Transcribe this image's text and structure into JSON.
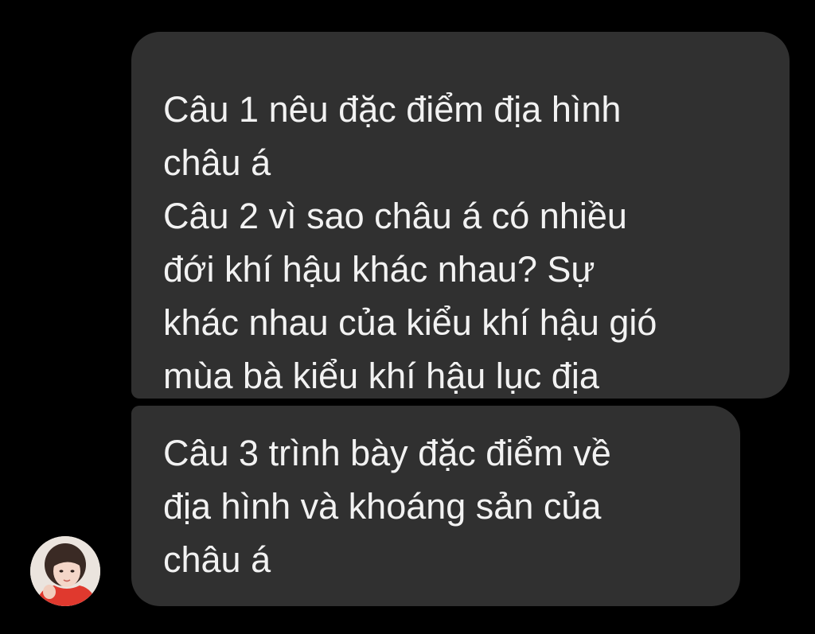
{
  "conversation": {
    "messages": [
      {
        "lines": [
          "Câu 1 nêu đặc điểm địa hình",
          "châu á",
          "Câu 2 vì sao châu á có nhiều",
          "đới khí hậu khác nhau? Sự",
          "khác nhau của kiểu khí hậu gió",
          "mùa bà kiểu khí hậu lục địa"
        ]
      },
      {
        "lines": [
          "Câu 3 trình bày đặc điểm về",
          "địa hình và khoáng sản của",
          "châu á"
        ]
      }
    ],
    "sender": {
      "avatar_icon": "profile-photo"
    }
  },
  "colors": {
    "background": "#000000",
    "bubble": "#303030",
    "text": "#f2f2f2"
  }
}
